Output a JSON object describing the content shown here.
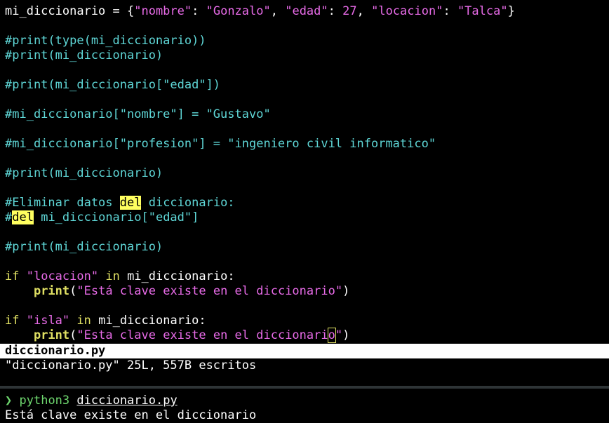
{
  "editor": {
    "line1": {
      "var": "mi_diccionario = {",
      "k1": "\"nombre\"",
      "s1": ": ",
      "v1": "\"Gonzalo\"",
      "s2": ", ",
      "k2": "\"edad\"",
      "s3": ": ",
      "v2": "27",
      "s4": ", ",
      "k3": "\"locacion\"",
      "s5": ": ",
      "v3": "\"Talca\"",
      "s6": "}"
    },
    "line3": "#print(type(mi_diccionario))",
    "line4": "#print(mi_diccionario)",
    "line6": "#print(mi_diccionario[\"edad\"])",
    "line8": "#mi_diccionario[\"nombre\"] = \"Gustavo\"",
    "line10": "#mi_diccionario[\"profesion\"] = \"ingeniero civil informatico\"",
    "line12": "#print(mi_diccionario)",
    "line14": {
      "a": "#Eliminar datos ",
      "hl": "del",
      "b": " diccionario:"
    },
    "line15": {
      "a": "#",
      "hl": "del",
      "b": " mi_diccionario[\"edad\"]"
    },
    "line17": "#print(mi_diccionario)",
    "line19": {
      "kw": "if",
      "sp": " ",
      "str": "\"locacion\"",
      "sp2": " ",
      "kw2": "in",
      "rest": " mi_diccionario:"
    },
    "line20": {
      "indent": "    ",
      "fn": "print",
      "p1": "(",
      "str": "\"Está clave existe en el diccionario\"",
      "p2": ")"
    },
    "line22": {
      "kw": "if",
      "sp": " ",
      "str": "\"isla\"",
      "sp2": " ",
      "kw2": "in",
      "rest": " mi_diccionario:"
    },
    "line23": {
      "indent": "    ",
      "fn": "print",
      "p1": "(",
      "str_a": "\"Esta clave existe en el diccionari",
      "cursor_char": "o",
      "str_b": "\"",
      "p2": ")"
    }
  },
  "statusline": {
    "filename": "diccionario.py"
  },
  "message": "\"diccionario.py\" 25L, 557B escritos",
  "terminal": {
    "prompt_symbol": "❯",
    "command": "python3",
    "argument": "diccionario.py",
    "output": "Está clave existe en el diccionario"
  },
  "colors": {
    "comment": "#5fd7d7",
    "string": "#e86be8",
    "keyword": "#e0e063",
    "search_highlight": "#ffff5f",
    "prompt": "#6fd86f"
  }
}
